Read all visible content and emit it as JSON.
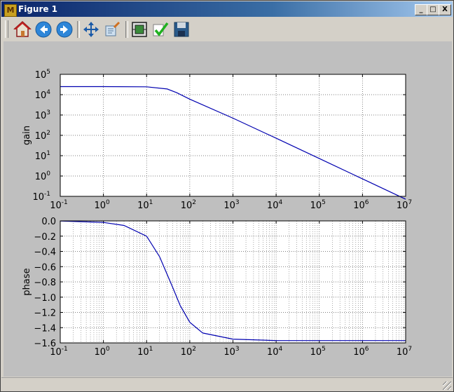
{
  "window": {
    "title": "Figure 1"
  },
  "window_controls": {
    "minimize": "_",
    "maximize": "□",
    "close": "X"
  },
  "toolbar": {
    "buttons": [
      {
        "name": "home-icon"
      },
      {
        "name": "back-icon"
      },
      {
        "name": "forward-icon"
      },
      {
        "name": "pan-icon"
      },
      {
        "name": "zoom-icon"
      },
      {
        "name": "subplots-icon"
      },
      {
        "name": "edit-icon"
      },
      {
        "name": "save-icon"
      }
    ]
  },
  "colors": {
    "line": "#0000b0",
    "figure_bg": "#bfbfbf",
    "axes_bg": "#ffffff",
    "grid": "#555555"
  },
  "chart_data": [
    {
      "type": "line",
      "ylabel": "gain",
      "xscale": "log",
      "yscale": "log",
      "xlim": [
        0.1,
        10000000
      ],
      "ylim": [
        0.1,
        100000
      ],
      "x_ticks": [
        {
          "base": "10",
          "exp": "-1"
        },
        {
          "base": "10",
          "exp": "0"
        },
        {
          "base": "10",
          "exp": "1"
        },
        {
          "base": "10",
          "exp": "2"
        },
        {
          "base": "10",
          "exp": "3"
        },
        {
          "base": "10",
          "exp": "4"
        },
        {
          "base": "10",
          "exp": "5"
        },
        {
          "base": "10",
          "exp": "6"
        },
        {
          "base": "10",
          "exp": "7"
        }
      ],
      "y_ticks": [
        {
          "base": "10",
          "exp": "-1"
        },
        {
          "base": "10",
          "exp": "0"
        },
        {
          "base": "10",
          "exp": "1"
        },
        {
          "base": "10",
          "exp": "2"
        },
        {
          "base": "10",
          "exp": "3"
        },
        {
          "base": "10",
          "exp": "4"
        },
        {
          "base": "10",
          "exp": "5"
        }
      ],
      "grid": true,
      "series": [
        {
          "x": [
            0.1,
            1,
            10,
            30,
            50,
            100,
            1000,
            10000,
            100000,
            1000000,
            10000000
          ],
          "y": [
            25000,
            25000,
            24300,
            19000,
            12500,
            6000,
            700,
            72,
            7.2,
            0.72,
            0.072
          ]
        }
      ]
    },
    {
      "type": "line",
      "ylabel": "phase",
      "xscale": "log",
      "yscale": "linear",
      "xlim": [
        0.1,
        10000000
      ],
      "ylim": [
        -1.6,
        0.0
      ],
      "x_ticks": [
        {
          "base": "10",
          "exp": "-1"
        },
        {
          "base": "10",
          "exp": "0"
        },
        {
          "base": "10",
          "exp": "1"
        },
        {
          "base": "10",
          "exp": "2"
        },
        {
          "base": "10",
          "exp": "3"
        },
        {
          "base": "10",
          "exp": "4"
        },
        {
          "base": "10",
          "exp": "5"
        },
        {
          "base": "10",
          "exp": "6"
        },
        {
          "base": "10",
          "exp": "7"
        }
      ],
      "y_ticks": [
        "0.0",
        "−0.2",
        "−0.4",
        "−0.6",
        "−0.8",
        "−1.0",
        "−1.2",
        "−1.4",
        "−1.6"
      ],
      "grid": true,
      "minor_grid_x": true,
      "series": [
        {
          "x": [
            0.1,
            1,
            3,
            10,
            20,
            40,
            60,
            100,
            200,
            1000,
            10000,
            10000000
          ],
          "y": [
            -0.002,
            -0.02,
            -0.06,
            -0.2,
            -0.47,
            -0.87,
            -1.11,
            -1.33,
            -1.47,
            -1.55,
            -1.57,
            -1.57
          ]
        }
      ]
    }
  ]
}
